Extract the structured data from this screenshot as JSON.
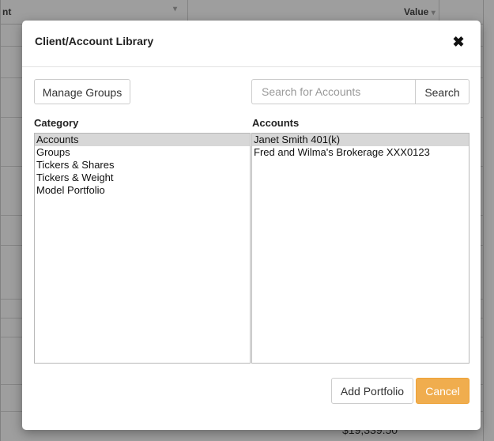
{
  "background": {
    "header_left": "nt",
    "header_right": "Value",
    "footer_value": "$19,339.50"
  },
  "modal": {
    "title": "Client/Account Library",
    "close_glyph": "✖",
    "manage_groups_label": "Manage Groups",
    "search": {
      "placeholder": "Search for Accounts",
      "value": "",
      "button_label": "Search"
    },
    "category": {
      "heading": "Category",
      "items": [
        {
          "label": "Accounts",
          "selected": true
        },
        {
          "label": "Groups",
          "selected": false
        },
        {
          "label": "Tickers & Shares",
          "selected": false
        },
        {
          "label": "Tickers & Weight",
          "selected": false
        },
        {
          "label": "Model Portfolio",
          "selected": false
        }
      ]
    },
    "accounts": {
      "heading": "Accounts",
      "items": [
        {
          "label": "Janet Smith 401(k)",
          "selected": true
        },
        {
          "label": "Fred and Wilma's Brokerage XXX0123",
          "selected": false
        }
      ]
    },
    "add_portfolio_label": "Add Portfolio",
    "cancel_label": "Cancel"
  },
  "colors": {
    "cancel_bg": "#f0ad4e",
    "selected_row_bg": "#d7d7d7",
    "overlay": "rgba(0,0,0,0.38)"
  },
  "icons": {
    "close": "close-icon",
    "sort": "sort-arrow-icon"
  }
}
